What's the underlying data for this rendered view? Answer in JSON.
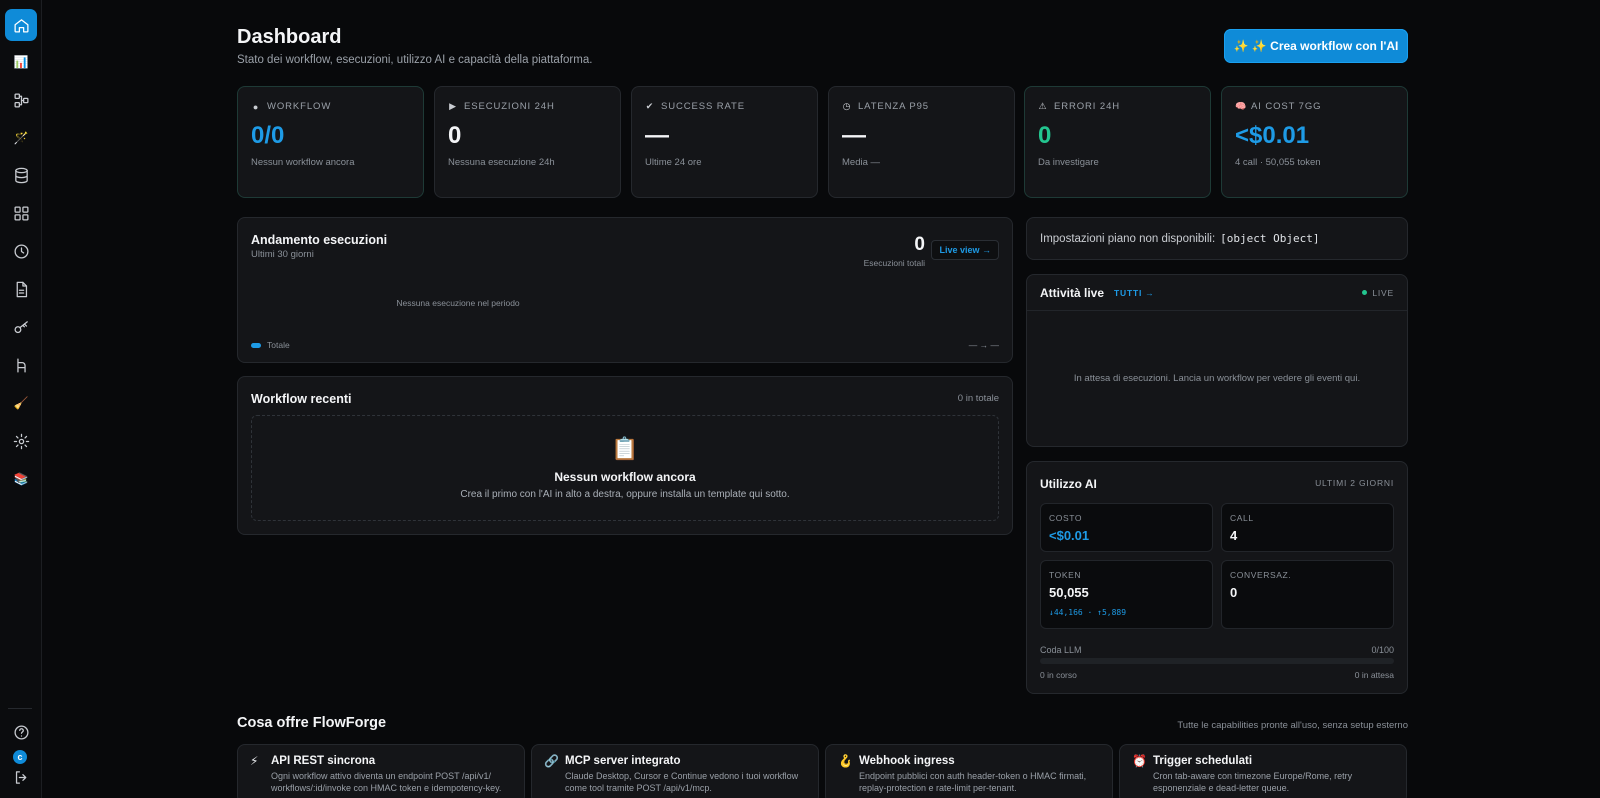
{
  "header": {
    "title": "Dashboard",
    "subtitle": "Stato dei workflow, esecuzioni, utilizzo AI e capacità della piattaforma.",
    "cta_label": "✨ ✨ Crea workflow con l'AI"
  },
  "sidebar": {
    "avatar_initial": "c",
    "items": [
      "home-icon",
      "chart-icon",
      "workflow-icon",
      "magic-wand-icon",
      "database-icon",
      "grid-icon",
      "clock-icon",
      "document-icon",
      "key-icon",
      "branch-icon",
      "broom-icon",
      "gear-icon",
      "books-icon",
      "help-icon",
      "logout-icon"
    ]
  },
  "kpis": [
    {
      "icon": "●",
      "label": "WORKFLOW",
      "value": "0/0",
      "sub": "Nessun workflow ancora",
      "value_color": "#1e9be6"
    },
    {
      "icon": "▶",
      "label": "ESECUZIONI 24H",
      "value": "0",
      "sub": "Nessuna esecuzione 24h"
    },
    {
      "icon": "✔",
      "label": "SUCCESS RATE",
      "value": "—",
      "sub": "Ultime 24 ore"
    },
    {
      "icon": "◷",
      "label": "LATENZA P95",
      "value": "—",
      "sub": "Media —"
    },
    {
      "icon": "⚠",
      "label": "ERRORI 24H",
      "value": "0",
      "sub": "Da investigare",
      "value_color": "#23c58f"
    },
    {
      "icon": "🧠",
      "label": "AI COST 7GG",
      "value": "<$0.01",
      "sub": "4 call · 50,055 token",
      "value_color": "#1e9be6"
    }
  ],
  "executions": {
    "title": "Andamento esecuzioni",
    "subtitle": "Ultimi 30 giorni",
    "total": "0",
    "total_label": "Esecuzioni totali",
    "live_view": "Live view →",
    "empty": "Nessuna esecuzione nel periodo",
    "legend": "Totale",
    "range": "— → —"
  },
  "recent": {
    "title": "Workflow recenti",
    "count": "0 in totale",
    "empty_icon": "📋",
    "empty_title": "Nessun workflow ancora",
    "empty_text": "Crea il primo con l'AI in alto a destra, oppure installa un template qui sotto."
  },
  "plan": {
    "message": "Impostazioni piano non disponibili:",
    "code": "[object Object]"
  },
  "live": {
    "title": "Attività live",
    "all_link": "TUTTI →",
    "status": "LIVE",
    "empty": "In attesa di esecuzioni. Lancia un workflow per vedere gli eventi qui."
  },
  "ai_usage": {
    "title": "Utilizzo AI",
    "period": "ULTIMI 2 GIORNI",
    "cost_label": "COSTO",
    "cost": "<$0.01",
    "call_label": "CALL",
    "calls": "4",
    "token_label": "TOKEN",
    "tokens": "50,055",
    "token_detail": "↓44,166 · ↑5,889",
    "conv_label": "CONVERSAZ.",
    "conversations": "0",
    "queue_label": "Coda LLM",
    "queue_count": "0/100",
    "queue_fraction": 0,
    "running": "0 in corso",
    "waiting": "0 in attesa"
  },
  "features": {
    "title": "Cosa offre FlowForge",
    "note": "Tutte le capabilities pronte all'uso, senza setup esterno",
    "items": [
      {
        "icon": "⚡",
        "title": "API REST sincrona",
        "desc": "Ogni workflow attivo diventa un endpoint POST /api/v1/ workflows/:id/invoke con HMAC token e idempotency-key."
      },
      {
        "icon": "🔗",
        "title": "MCP server integrato",
        "desc": "Claude Desktop, Cursor e Continue vedono i tuoi workflow come tool tramite POST /api/v1/mcp."
      },
      {
        "icon": "🪝",
        "title": "Webhook ingress",
        "desc": "Endpoint pubblici con auth header-token o HMAC firmati, replay-protection e rate-limit per-tenant."
      },
      {
        "icon": "⏰",
        "title": "Trigger schedulati",
        "desc": "Cron tab-aware con timezone Europe/Rome, retry esponenziale e dead-letter queue."
      }
    ]
  }
}
